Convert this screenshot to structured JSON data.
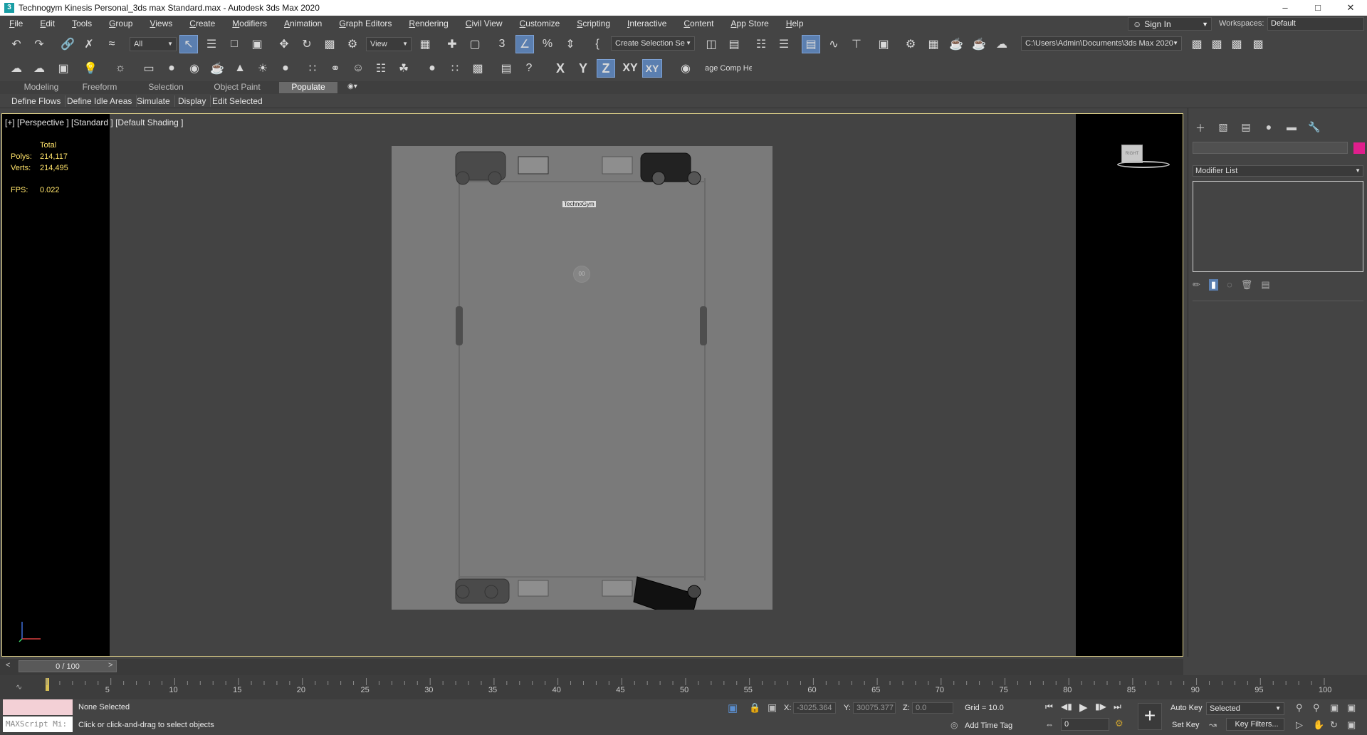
{
  "window": {
    "title": "Technogym Kinesis Personal_3ds max Standard.max - Autodesk 3ds Max 2020",
    "app_icon": "3ds-max-icon",
    "buttons": [
      "–",
      "□",
      "✕"
    ]
  },
  "menu": [
    "File",
    "Edit",
    "Tools",
    "Group",
    "Views",
    "Create",
    "Modifiers",
    "Animation",
    "Graph Editors",
    "Rendering",
    "Civil View",
    "Customize",
    "Scripting",
    "Interactive",
    "Content",
    "App Store",
    "Help"
  ],
  "account": {
    "sign_in": "Sign In",
    "workspaces_label": "Workspaces:",
    "workspace": "Default"
  },
  "toolbar": {
    "selection_filter": "All",
    "reference_coord": "View",
    "named_selection": "Create Selection Se",
    "project_path": "C:\\Users\\Admin\\Documents\\3ds Max 2020",
    "axis_x": "X",
    "axis_y": "Y",
    "axis_z": "Z",
    "axis_xy": "XY",
    "axis_xy2": "XY",
    "image_comp": "age Comp Help"
  },
  "ribbon": {
    "tabs": [
      "Modeling",
      "Freeform",
      "Selection",
      "Object Paint",
      "Populate"
    ],
    "active_tab": "Populate",
    "buttons": [
      "Define Flows",
      "Define Idle Areas",
      "Simulate",
      "Display",
      "Edit Selected"
    ]
  },
  "viewport": {
    "label": "[+] [Perspective ] [Standard ] [Default Shading ]",
    "stats": {
      "total": "Total",
      "polys_label": "Polys:",
      "polys": "214,117",
      "verts_label": "Verts:",
      "verts": "214,495",
      "fps_label": "FPS:",
      "fps": "0.022"
    },
    "model_brand": "TechnoGym",
    "model_badge": "00",
    "viewcube_label": "RIGHT"
  },
  "command_panel": {
    "modifier_list": "Modifier List",
    "object_color": "#e01e8c"
  },
  "timeline": {
    "frame": "0 / 100",
    "ticks": [
      "5",
      "10",
      "15",
      "20",
      "25",
      "30",
      "35",
      "40",
      "45",
      "50",
      "55",
      "60",
      "65",
      "70",
      "75",
      "80",
      "85",
      "90",
      "95",
      "100"
    ]
  },
  "status": {
    "maxscript": "MAXScript Mi:",
    "selection": "None Selected",
    "prompt": "Click or click-and-drag to select objects",
    "x_label": "X:",
    "x": "-3025.364",
    "y_label": "Y:",
    "y": "30075.377",
    "z_label": "Z:",
    "z": "0.0",
    "grid": "Grid = 10.0",
    "add_time_tag": "Add Time Tag",
    "auto_key": "Auto Key",
    "set_key": "Set Key",
    "key_mode": "Selected",
    "key_filters": "Key Filters...",
    "current_frame": "0"
  }
}
